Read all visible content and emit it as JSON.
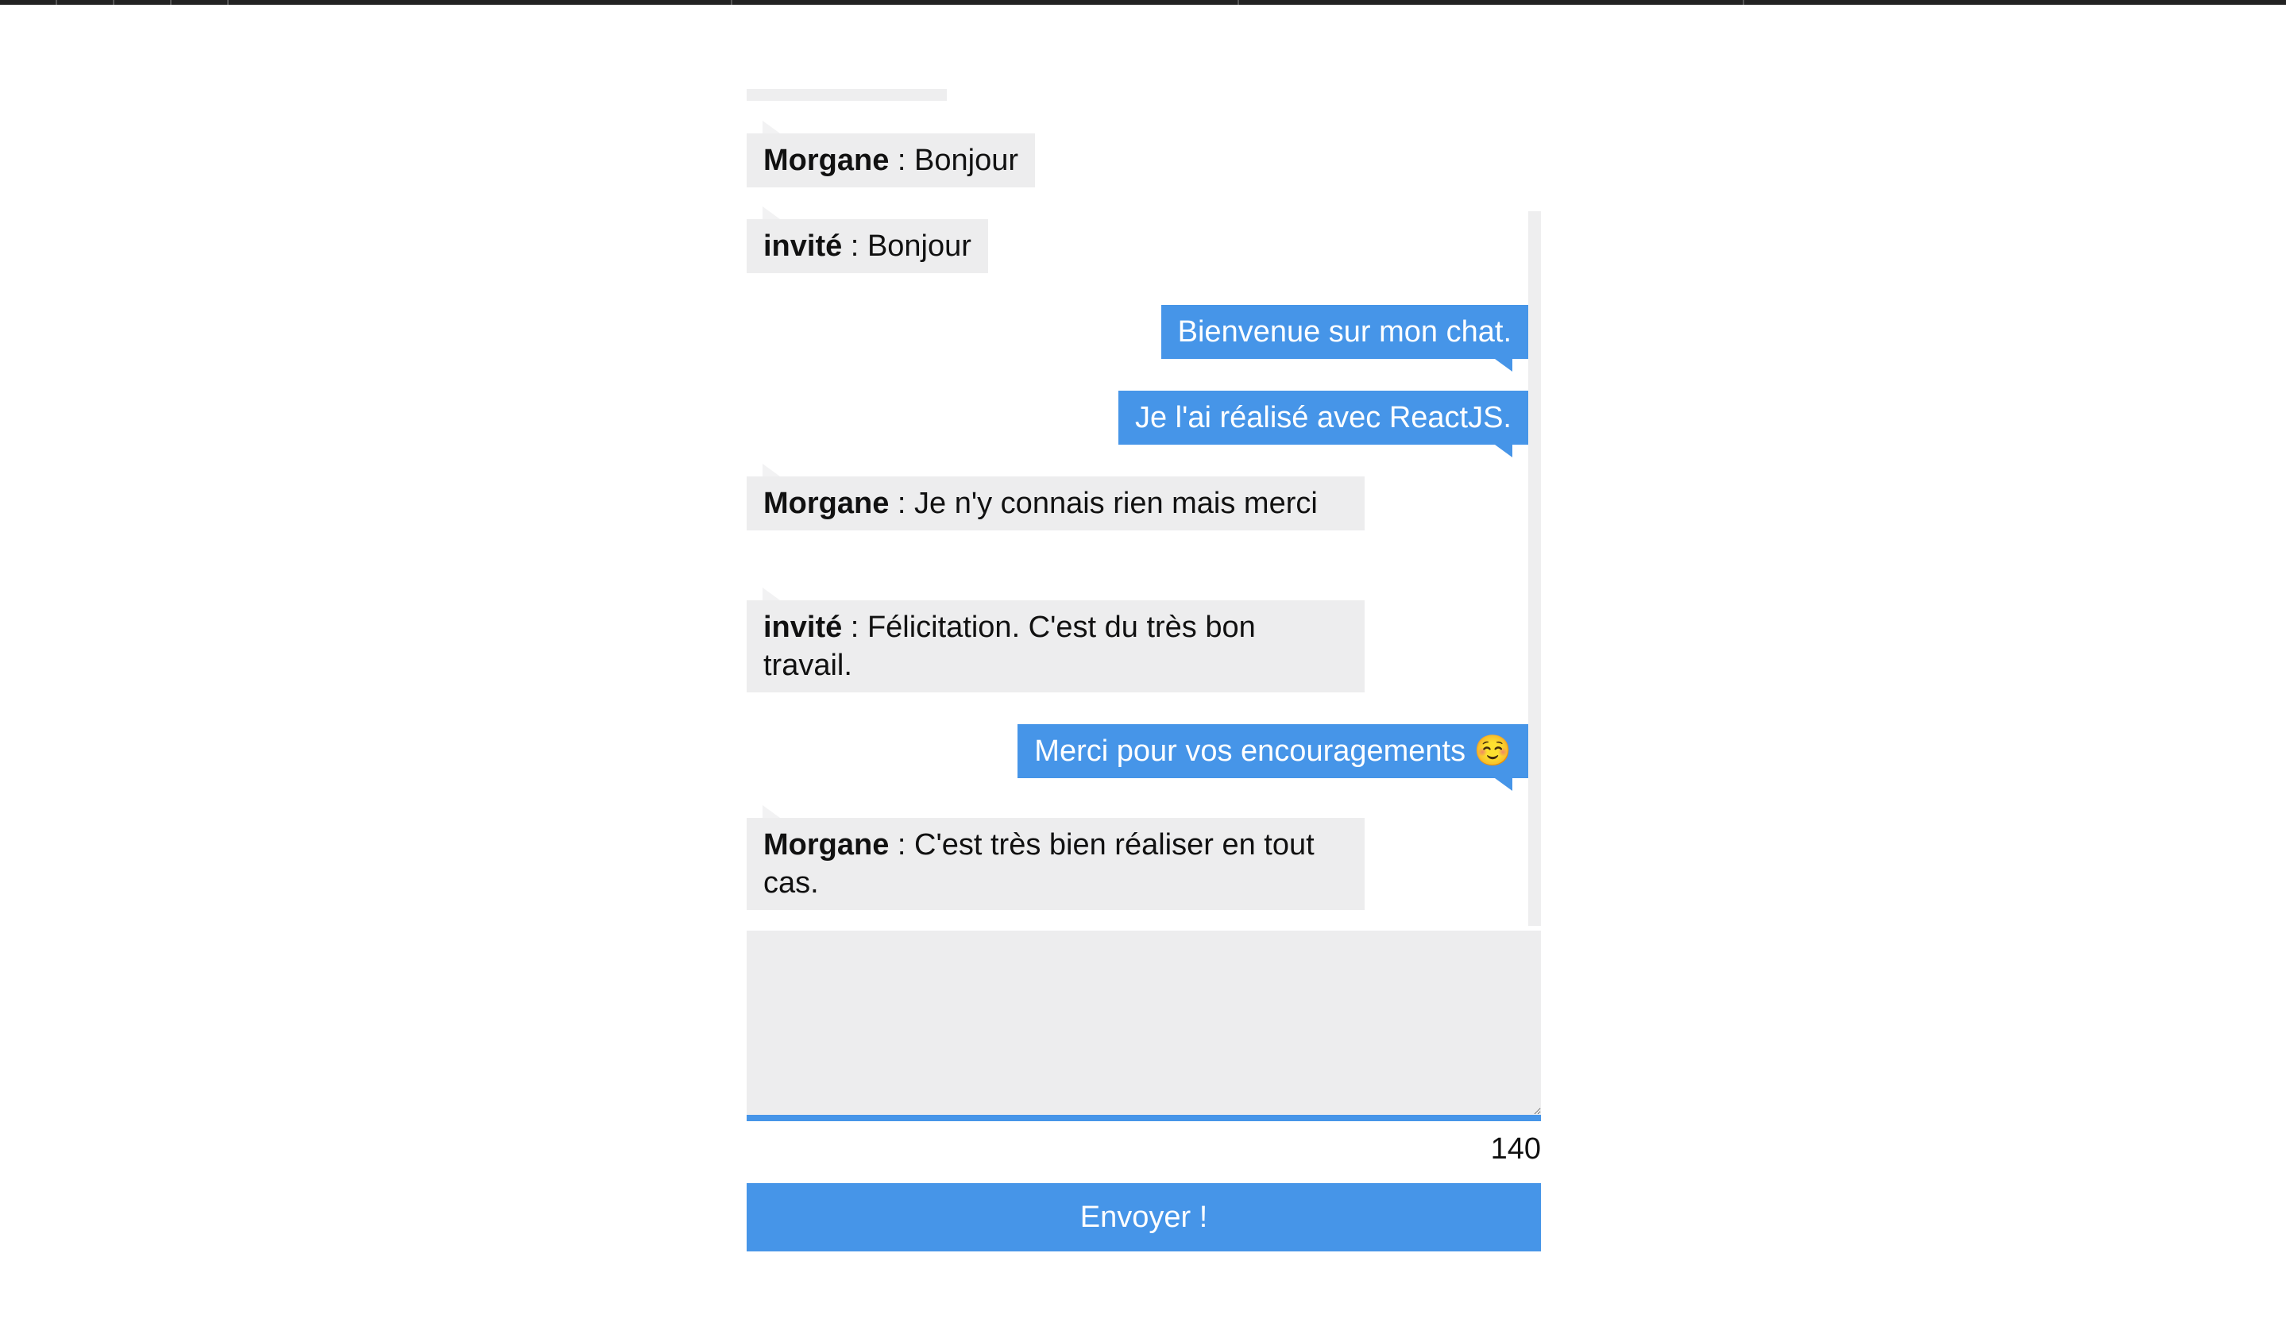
{
  "chat": {
    "messages": [
      {
        "side": "left",
        "author": "Morgane",
        "sep": " : ",
        "text": "Bonjour"
      },
      {
        "side": "left",
        "author": "invité",
        "sep": " : ",
        "text": "Bonjour"
      },
      {
        "side": "right",
        "text": "Bienvenue sur mon chat."
      },
      {
        "side": "right",
        "text": "Je l'ai réalisé avec ReactJS."
      },
      {
        "side": "left",
        "author": "Morgane",
        "sep": " : ",
        "text": "Je n'y connais rien mais merci"
      },
      {
        "side": "left",
        "author": "invité",
        "sep": " : ",
        "text": "Félicitation. C'est du très bon travail."
      },
      {
        "side": "right",
        "text": "Merci pour vos encouragements ☺️"
      },
      {
        "side": "left",
        "author": "Morgane",
        "sep": " : ",
        "text": "C'est très bien réaliser en tout cas."
      }
    ]
  },
  "composer": {
    "input_value": "",
    "counter": "140",
    "send_label": "Envoyer !"
  },
  "colors": {
    "accent": "#4695e8",
    "bubble_received": "#ededee",
    "topbar": "#222222"
  }
}
